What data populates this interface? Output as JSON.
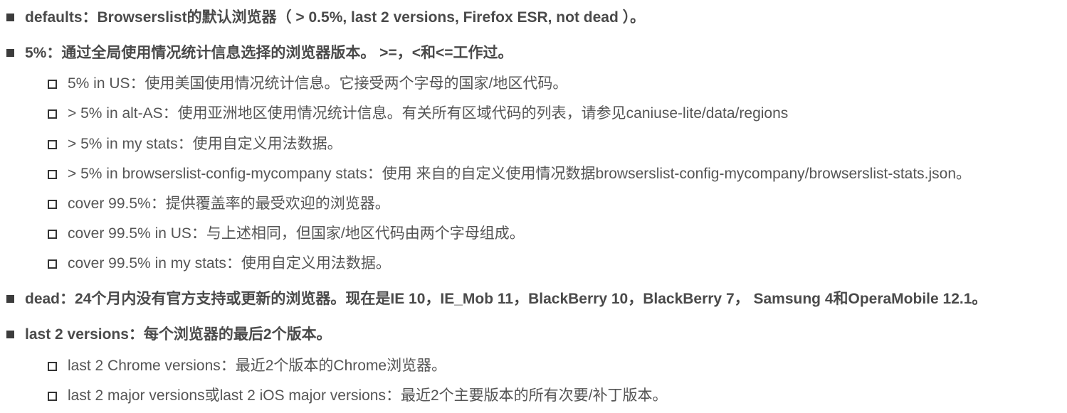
{
  "items": [
    {
      "level": 1,
      "text": "defaults：Browserslist的默认浏览器（ > 0.5%, last 2 versions, Firefox ESR, not dead ）。"
    },
    {
      "level": 1,
      "text": "5%：通过全局使用情况统计信息选择的浏览器版本。 >=，<和<=工作过。"
    },
    {
      "level": 2,
      "text": "5% in US：使用美国使用情况统计信息。它接受两个字母的国家/地区代码。"
    },
    {
      "level": 2,
      "text": "> 5% in alt-AS：使用亚洲地区使用情况统计信息。有关所有区域代码的列表，请参见caniuse-lite/data/regions"
    },
    {
      "level": 2,
      "text": "> 5% in my stats：使用自定义用法数据。"
    },
    {
      "level": 2,
      "text": "> 5% in browserslist-config-mycompany stats：使用 来自的自定义使用情况数据browserslist-config-mycompany/browserslist-stats.json。"
    },
    {
      "level": 2,
      "text": "cover 99.5%：提供覆盖率的最受欢迎的浏览器。"
    },
    {
      "level": 2,
      "text": "cover 99.5% in US：与上述相同，但国家/地区代码由两个字母组成。"
    },
    {
      "level": 2,
      "text": "cover 99.5% in my stats：使用自定义用法数据。"
    },
    {
      "level": 1,
      "text": "dead：24个月内没有官方支持或更新的浏览器。现在是IE 10，IE_Mob 11，BlackBerry 10，BlackBerry 7， Samsung 4和OperaMobile 12.1。"
    },
    {
      "level": 1,
      "text": "last 2 versions：每个浏览器的最后2个版本。"
    },
    {
      "level": 2,
      "text": "last 2 Chrome versions：最近2个版本的Chrome浏览器。"
    },
    {
      "level": 2,
      "text": "last 2 major versions或last 2 iOS major versions：最近2个主要版本的所有次要/补丁版本。"
    }
  ]
}
